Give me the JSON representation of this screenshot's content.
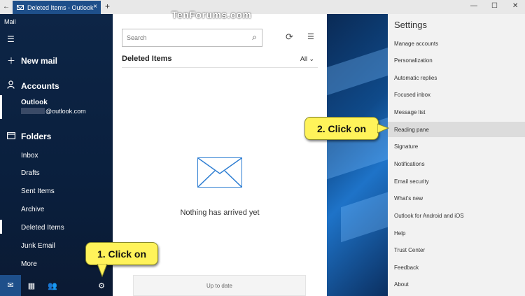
{
  "window": {
    "tab_title": "Deleted Items - Outlook",
    "tab_close": "×",
    "new_tab": "+",
    "back": "←",
    "minimize": "—",
    "maximize": "☐",
    "close": "✕",
    "watermark": "TenForums.com"
  },
  "nav": {
    "app_label": "Mail",
    "menu_icon": "hamburger-icon",
    "new_mail": "New mail",
    "accounts": "Accounts",
    "account_name": "Outlook",
    "account_email_suffix": "@outlook.com",
    "folders_heading": "Folders",
    "folders": [
      {
        "label": "Inbox"
      },
      {
        "label": "Drafts"
      },
      {
        "label": "Sent Items"
      },
      {
        "label": "Archive"
      },
      {
        "label": "Deleted Items",
        "selected": true
      },
      {
        "label": "Junk Email"
      },
      {
        "label": "More"
      }
    ]
  },
  "list": {
    "search_placeholder": "Search",
    "folder_title": "Deleted Items",
    "filter": "All",
    "empty_message": "Nothing has arrived yet",
    "status": "Up to date"
  },
  "settings": {
    "title": "Settings",
    "items": [
      {
        "label": "Manage accounts"
      },
      {
        "label": "Personalization"
      },
      {
        "label": "Automatic replies"
      },
      {
        "label": "Focused inbox"
      },
      {
        "label": "Message list"
      },
      {
        "label": "Reading pane",
        "highlighted": true
      },
      {
        "label": "Signature"
      },
      {
        "label": "Notifications"
      },
      {
        "label": "Email security"
      },
      {
        "label": "What's new"
      },
      {
        "label": "Outlook for Android and iOS"
      },
      {
        "label": "Help"
      },
      {
        "label": "Trust Center"
      },
      {
        "label": "Feedback"
      },
      {
        "label": "About"
      }
    ]
  },
  "callouts": {
    "step1": "1. Click on",
    "step2": "2. Click on"
  },
  "colors": {
    "accent": "#1e4f8a",
    "callout": "#fff35a",
    "envelope": "#2d7dd2"
  }
}
